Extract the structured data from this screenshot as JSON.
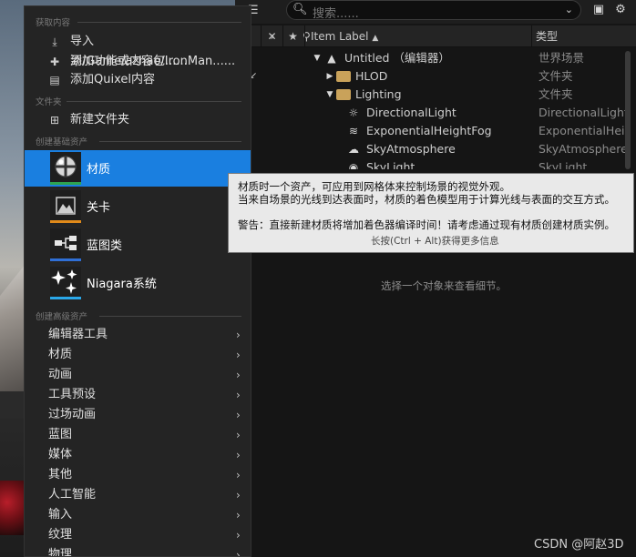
{
  "outliner": {
    "search_placeholder": "搜索......",
    "col_item_label": "Item Label",
    "col_sort_icon": "▲",
    "col_type": "类型",
    "rows": [
      {
        "label": "Untitled （编辑器）",
        "type": "世界场景"
      },
      {
        "label": "HLOD",
        "type": "文件夹"
      },
      {
        "label": "Lighting",
        "type": "文件夹"
      },
      {
        "label": "DirectionalLight",
        "type": "DirectionalLight"
      },
      {
        "label": "ExponentialHeightFog",
        "type": "ExponentialHeightFog"
      },
      {
        "label": "SkyAtmosphere",
        "type": "SkyAtmosphere"
      },
      {
        "label": "SkyLight",
        "type": "SkyLight"
      }
    ],
    "details_empty": "选择一个对象来查看细节。"
  },
  "menu": {
    "section_get_content": "获取内容",
    "import_label": "导入到/Game/azhao/IronMan......",
    "add_feature_label": "添加功能或内容包......",
    "add_quixel_label": "添加Quixel内容",
    "section_folder": "文件夹",
    "new_folder_label": "新建文件夹",
    "section_basic_assets": "创建基础资产",
    "assets": [
      {
        "label": "材质",
        "color": "#2ea44f"
      },
      {
        "label": "关卡",
        "color": "#e08a1a"
      },
      {
        "label": "蓝图类",
        "color": "#2f6fd6"
      },
      {
        "label": "Niagara系统",
        "color": "#2aa7e8"
      }
    ],
    "section_advanced_assets": "创建高级资产",
    "submenus": [
      "编辑器工具",
      "材质",
      "动画",
      "工具预设",
      "过场动画",
      "蓝图",
      "媒体",
      "其他",
      "人工智能",
      "输入",
      "纹理",
      "物理"
    ]
  },
  "tooltip": {
    "line1": "材质时一个资产，可应用到网格体来控制场景的视觉外观。",
    "line2": "当来自场景的光线到达表面时，材质的着色模型用于计算光线与表面的交互方式。",
    "line3": "警告：直接新建材质将增加着色器编译时间！请考虑通过现有材质创建材质实例。",
    "line4": "长按(Ctrl + Alt)获得更多信息"
  },
  "watermark": "CSDN @阿赵3D",
  "colors": {
    "selection": "#1a7fe0",
    "folder": "#c9a25a"
  }
}
